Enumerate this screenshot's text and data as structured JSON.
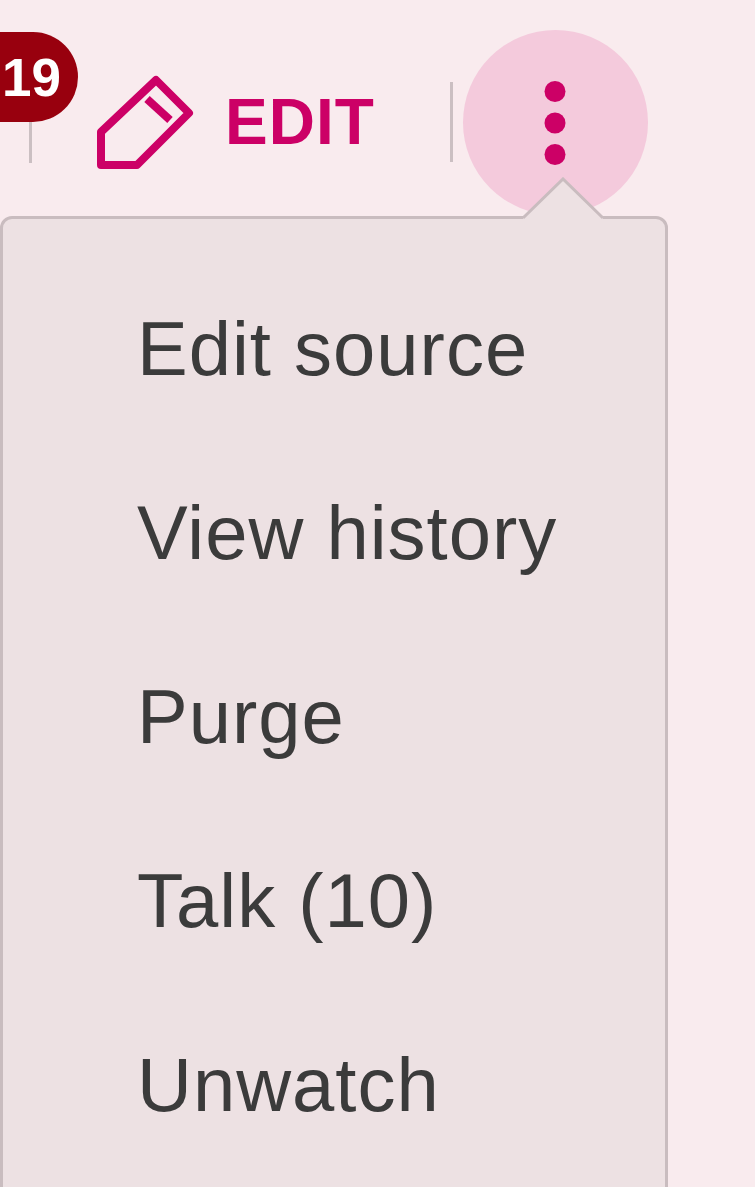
{
  "toolbar": {
    "notification_badge": "19",
    "edit_button": {
      "label": "EDIT"
    },
    "more_button": {
      "expanded": true
    }
  },
  "menu": {
    "items": [
      {
        "label": "Edit source"
      },
      {
        "label": "View history"
      },
      {
        "label": "Purge"
      },
      {
        "label": "Talk (10)"
      },
      {
        "label": "Unwatch"
      }
    ]
  }
}
